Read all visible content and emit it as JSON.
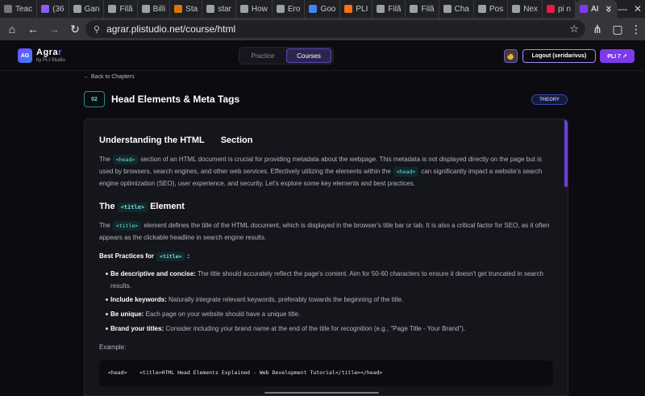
{
  "browser": {
    "tabs": [
      {
        "label": "Teac",
        "color": "#777777"
      },
      {
        "label": "(36",
        "color": "#8b5cf6"
      },
      {
        "label": "Gan",
        "color": "#9aa0a6"
      },
      {
        "label": "Filă",
        "color": "#9aa0a6"
      },
      {
        "label": "Billi",
        "color": "#9aa0a6"
      },
      {
        "label": "Sta",
        "color": "#d97706"
      },
      {
        "label": "star",
        "color": "#9aa0a6"
      },
      {
        "label": "How",
        "color": "#9aa0a6"
      },
      {
        "label": "Ero",
        "color": "#9aa0a6"
      },
      {
        "label": "Goo",
        "color": "#4285f4"
      },
      {
        "label": "PLI",
        "color": "#f97316"
      },
      {
        "label": "Filă",
        "color": "#9aa0a6"
      },
      {
        "label": "Filă",
        "color": "#9aa0a6"
      },
      {
        "label": "Cha",
        "color": "#9aa0a6"
      },
      {
        "label": "Pos",
        "color": "#9aa0a6"
      },
      {
        "label": "Nex",
        "color": "#9aa0a6"
      },
      {
        "label": "pi n",
        "color": "#e11d48"
      },
      {
        "label": "AI",
        "color": "#7c3aed"
      }
    ],
    "url": "agrar.plistudio.net/course/html"
  },
  "app": {
    "logo_initials": "AG",
    "logo_name_a": "Agra",
    "logo_name_b": "r",
    "logo_sub": "by PLI Studio",
    "nav": {
      "practice": "Practice",
      "courses": "Courses"
    },
    "logout": "Logout (seridarivus)",
    "pli_button": "PLI 7 ↗"
  },
  "page": {
    "back": "← Back to Chapters",
    "chapter_number": "02",
    "chapter_title": "Head Elements & Meta Tags",
    "badge": "THEORY"
  },
  "article": {
    "s1_heading_a": "Understanding the HTML",
    "s1_heading_b": "Section",
    "s1_p_1": "The",
    "s1_code_1": "<head>",
    "s1_p_2": "section of an HTML document is crucial for providing metadata about the webpage. This metadata is not displayed directly on the page but is used by browsers, search engines, and other web services. Effectively utilizing the elements within the",
    "s1_code_2": "<head>",
    "s1_p_3": "can significantly impact a website's search engine optimization (SEO), user experience, and security. Let's explore some key elements and best practices.",
    "s2_heading_a": "The",
    "s2_code": "<title>",
    "s2_heading_b": "Element",
    "s2_p_1": "The",
    "s2_code_1": "<title>",
    "s2_p_2": "element defines the title of the HTML document, which is displayed in the browser's title bar or tab. It is also a critical factor for SEO, as it often appears as the clickable headline in search engine results.",
    "bp_label": "Best Practices for",
    "bp_code": "<title>",
    "bp_colon": ":",
    "bullets": [
      {
        "strong": "Be descriptive and concise:",
        "text": "The title should accurately reflect the page's content. Aim for 50-60 characters to ensure it doesn't get truncated in search results."
      },
      {
        "strong": "Include keywords:",
        "text": "Naturally integrate relevant keywords, preferably towards the beginning of the title."
      },
      {
        "strong": "Be unique:",
        "text": "Each page on your website should have a unique title."
      },
      {
        "strong": "Brand your titles:",
        "text": "Consider including your brand name at the end of the title for recognition (e.g., \"Page Title - Your Brand\")."
      }
    ],
    "example_label": "Example:",
    "example_code": "<head>    <title>HTML Head Elements Explained - Web Development Tutorial</title></head>"
  }
}
